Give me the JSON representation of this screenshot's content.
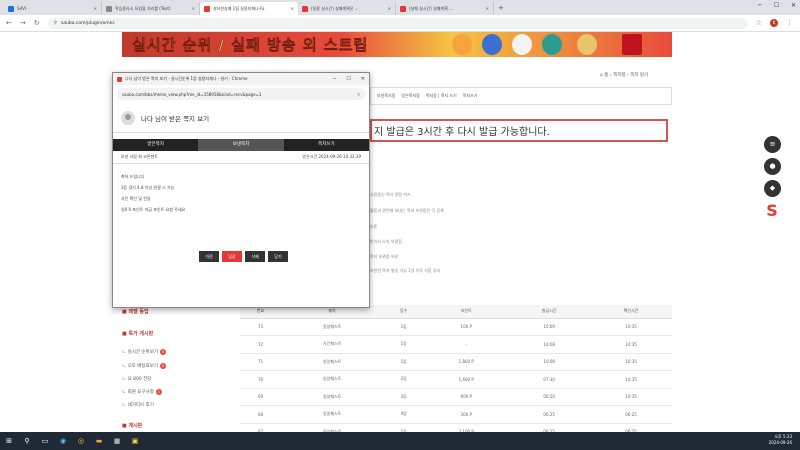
{
  "browser": {
    "tabs": [
      {
        "label": "SAVI",
        "color": "#1a73e8"
      },
      {
        "label": "학습용사소 모킹을 처리를 (Text)",
        "color": "#888888"
      },
      {
        "label": "설하한실패 1됨 실용지재나-Fa",
        "color": "#e53935",
        "active": true
      },
      {
        "label": "(실용 실시간) 실패계획은 ...",
        "color": "#e53935"
      },
      {
        "label": "(실패 실시간) 실패계획 ...",
        "color": "#e53935"
      }
    ],
    "new_tab": "+",
    "url": "sauba.com/plugin/omec",
    "profile_initial": "K"
  },
  "banner": {
    "text": "실시간 순위 / 실패 방송 외 스트립"
  },
  "page": {
    "breadcrumb": "⌂ 홈 › 쪽지함 › 쪽지 읽기",
    "menu_items": [
      "보낸쪽지함",
      "받은쪽지함 ",
      "쪽지함 | 쪽지 쓰기 ",
      "쪽지쓰기"
    ],
    "notice": "지 발급은 3시간 후 다시 발급 가능합니다.",
    "bg_lines": [
      "사용중인 쪽지 알람 켜기",
      "활동과 관련해 보내는 쪽지 보관함은 각 등록",
      "보존",
      "받아서 오라 보관함",
      "쪽지 보관함 보관",
      "보관한 쪽지 발송 가능 1일 이후 자동 정리",
      "보관함 기간 등급, 포인트 과 보관 기간 등 기능이"
    ]
  },
  "sidebar": {
    "title1": "■ 레벨 등업",
    "section_title": "■ 특가 게시판",
    "items": [
      {
        "label": "ㄴ 실시간 순위보기",
        "badge": "3"
      },
      {
        "label": "ㄴ 오토 베팅표보기",
        "badge": "5"
      },
      {
        "label": "ㄴ 요 800 전당",
        "badge": ""
      },
      {
        "label": "ㄴ 회원 요구사항",
        "badge": "1"
      },
      {
        "label": "ㄴ 네거티브 후기",
        "badge": ""
      }
    ],
    "section2_title": "■ 게시판"
  },
  "table": {
    "headers": [
      "번호",
      "제목",
      "등수",
      "포인트",
      "발급시간",
      "확인시간"
    ],
    "rows": [
      [
        "73",
        "일일퀘스트",
        "1등",
        "100 P",
        "10:09",
        "10:35"
      ],
      [
        "72",
        "기간퀘스트",
        "1등",
        "-",
        "10:08",
        "10:35"
      ],
      [
        "71",
        "일일퀘스트",
        "1등",
        "1,800 P",
        "10:08",
        "10:35"
      ],
      [
        "70",
        "일일퀘스트",
        "2등",
        "1,600 P",
        "07:30",
        "10:35"
      ],
      [
        "69",
        "일일퀘스트",
        "3등",
        "600 P",
        "06:50",
        "10:35"
      ],
      [
        "68",
        "일일퀘스트",
        "4등",
        "300 P",
        "06:25",
        "06:25"
      ],
      [
        "67",
        "일일퀘스트",
        "1등",
        "2,100 P",
        "06:25",
        "06:25"
      ]
    ]
  },
  "popup": {
    "window_title": "나다 님이 받은 쪽지 보기 - 실시간순위 1등 설용지재나 - 설기 - Chrome",
    "url": "sauba.com/bbs/memo_view.php?me_id=358958&kind=recv&page=1",
    "header": "나다 님이 받은 쪽지 보기",
    "tabs": [
      "받은쪽지",
      "보낸쪽지",
      "쪽지쓰기"
    ],
    "sender": "보낸 사람 회 코튼덴트",
    "date": "받은시간 2024-09-26 10:32:39",
    "body_lines": [
      "축하 드립니다",
      "3등 경기 4.8 이상 연결 시 가능",
      "사진 확인 및 전달 ",
      "일0 0 포인트 지급 포인트 요청 주세요"
    ],
    "buttons": [
      "이전",
      "답장",
      "삭제",
      "닫기"
    ]
  },
  "taskbar": {
    "time": "오후 5:33",
    "date": "2024-09-26"
  }
}
